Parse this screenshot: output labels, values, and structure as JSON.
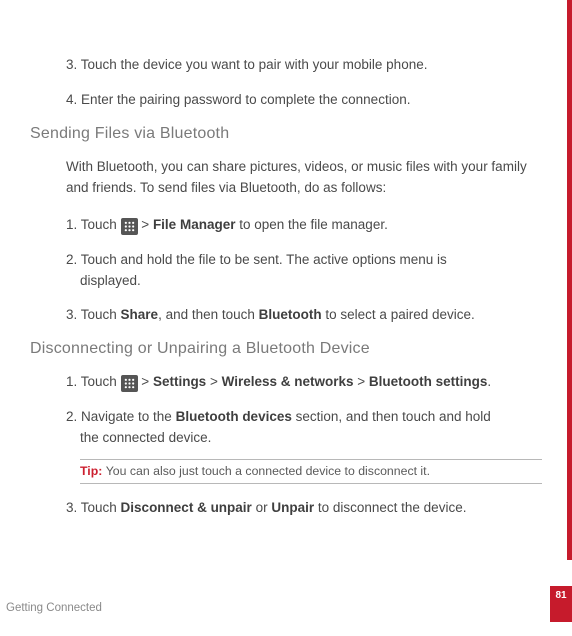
{
  "steps_top": {
    "s3": "3. Touch the device you want to pair with your mobile phone.",
    "s4": "4. Enter the pairing password to complete the connection."
  },
  "sending": {
    "heading": "Sending Files via Bluetooth",
    "intro": "With Bluetooth, you can share pictures, videos, or music files with your family and friends. To send files via Bluetooth, do as follows:",
    "s1_a": "1. Touch ",
    "s1_b": " > ",
    "s1_bold1": "File Manager",
    "s1_c": " to open the file manager.",
    "s2_a": "2. Touch and hold the file to be sent. The active options menu is",
    "s2_b": "displayed.",
    "s3_a": "3. Touch ",
    "s3_bold1": "Share",
    "s3_b": ", and then touch ",
    "s3_bold2": "Bluetooth",
    "s3_c": " to select a paired device."
  },
  "disconnect": {
    "heading": "Disconnecting or Unpairing a Bluetooth Device",
    "s1_a": "1. Touch ",
    "s1_b": " > ",
    "s1_bold1": "Settings",
    "s1_c": " > ",
    "s1_bold2": "Wireless & networks",
    "s1_d": " > ",
    "s1_bold3": "Bluetooth settings",
    "s1_e": ".",
    "s2_a": "2. Navigate to the ",
    "s2_bold1": "Bluetooth devices",
    "s2_b": " section, and then touch and hold",
    "s2_c": "the connected device.",
    "tip_label": "Tip:  ",
    "tip_text": "You can also just touch a connected device to disconnect it.",
    "s3_a": "3. Touch ",
    "s3_bold1": "Disconnect & unpair",
    "s3_b": " or ",
    "s3_bold2": "Unpair",
    "s3_c": " to disconnect the device."
  },
  "footer": "Getting Connected",
  "page_num": "81"
}
